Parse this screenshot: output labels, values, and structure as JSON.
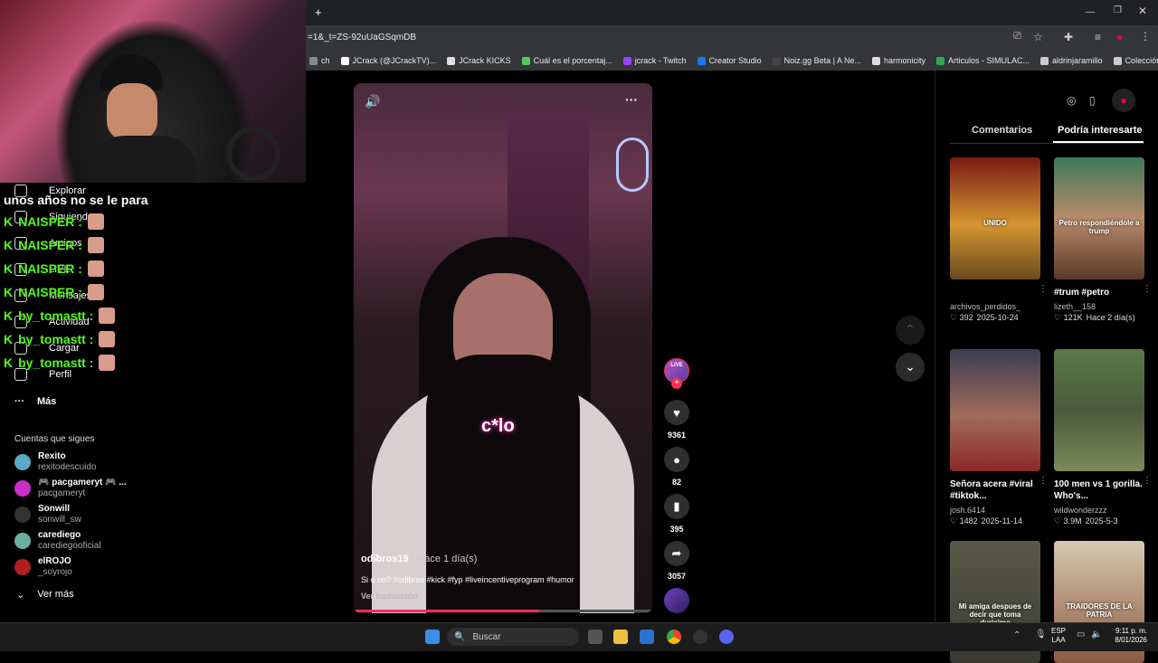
{
  "browser": {
    "new_tab": "+",
    "url": "=1&_t=ZS-92uUaGSqmDB",
    "bookmarks": [
      {
        "label": "ch",
        "color": "#888"
      },
      {
        "label": "JCrack (@JCrackTV)...",
        "color": "#fff"
      },
      {
        "label": "JCrack KICKS",
        "color": "#ddd"
      },
      {
        "label": "Cuál es el porcentaj...",
        "color": "#53c853"
      },
      {
        "label": "jcrack - Twitch",
        "color": "#9146ff"
      },
      {
        "label": "Creator Studio",
        "color": "#1877f2"
      },
      {
        "label": "Noiz.gg Beta | A Ne...",
        "color": "#444"
      },
      {
        "label": "harmonicity",
        "color": "#ddd"
      },
      {
        "label": "Articulos - SIMULAC...",
        "color": "#34a853"
      },
      {
        "label": "aldrinjaramillo",
        "color": "#ccc"
      },
      {
        "label": "Colección de M_blei...",
        "color": "#ccc"
      }
    ],
    "more": "»"
  },
  "sidebar": {
    "nav": [
      {
        "label": "Explorar",
        "icon": "compass-icon"
      },
      {
        "label": "Siguiendo",
        "icon": "following-icon"
      },
      {
        "label": "Amigos",
        "icon": "friends-icon"
      },
      {
        "label": "LIVE",
        "icon": "live-icon"
      },
      {
        "label": "Mensajes",
        "icon": "messages-icon"
      },
      {
        "label": "Actividad",
        "icon": "activity-icon"
      },
      {
        "label": "Cargar",
        "icon": "upload-icon"
      },
      {
        "label": "Perfil",
        "icon": "profile-icon"
      }
    ],
    "more": "Más",
    "following_title": "Cuentas que sigues",
    "following": [
      {
        "name": "Rexito",
        "handle": "rexitodescuido",
        "color": "#5aa9c9"
      },
      {
        "name": "🎮 pacgameryt 🎮 ...",
        "handle": "pacgameryt",
        "color": "#c92ec9"
      },
      {
        "name": "Sonwill",
        "handle": "sonwill_sw",
        "color": "#333"
      },
      {
        "name": "carediego",
        "handle": "carediegooficial",
        "color": "#6ab0a0"
      },
      {
        "name": "elROJO",
        "handle": "_soyrojo",
        "color": "#b02020"
      }
    ],
    "see_more": "Ver más"
  },
  "chat": {
    "top_line": "unos años no se le para",
    "messages": [
      {
        "user": "NAISPER :",
        "k": "K"
      },
      {
        "user": "NAISPER :",
        "k": "K"
      },
      {
        "user": "NAISPER :",
        "k": "K"
      },
      {
        "user": "NAISPER :",
        "k": "K"
      },
      {
        "user": "by_tomastt :",
        "k": "K"
      },
      {
        "user": "by_tomastt :",
        "k": "K"
      },
      {
        "user": "by_tomastt :",
        "k": "K"
      }
    ]
  },
  "video": {
    "caption_overlay": "c*lo",
    "author": "odibros19",
    "time": " · Hace 1 día(s)",
    "description": "Si o no? #odibros #kick #fyp #liveincentiveprogram #humor",
    "translate": "Ver traducción",
    "progress": 0.62
  },
  "actions": {
    "live_badge": "LIVE",
    "likes": "9361",
    "comments": "82",
    "saves": "395",
    "shares": "3057"
  },
  "right_panel": {
    "tabs": [
      "Comentarios",
      "Podría interesarte"
    ],
    "active_tab": 1,
    "cards": [
      {
        "title": "",
        "user": "archivos_perdidos_",
        "likes": "392",
        "date": "2025-10-24",
        "overlay": "UNIDO",
        "bg": "linear-gradient(180deg,#7a1a14 0%,#d49530 55%,#6a4a20 100%)"
      },
      {
        "title": "#trum #petro",
        "user": "lizeth__158",
        "likes": "121K",
        "date": "Hace 2 día(s)",
        "overlay": "Petro respondiéndole a trump",
        "bg": "linear-gradient(180deg,#3e7a5a 0%,#b88a6a 50%,#5a3a2a 100%)"
      },
      {
        "title": "Señora acera #viral #tiktok...",
        "user": "josh.6414",
        "likes": "1482",
        "date": "2025-11-14",
        "overlay": "",
        "bg": "linear-gradient(180deg,#3a3e50 0%,#a06a5a 55%,#8a2a2a 100%)"
      },
      {
        "title": "100 men vs 1 gorilla. Who's...",
        "user": "wildwonderzzz",
        "likes": "3.9M",
        "date": "2025-5-3",
        "overlay": "",
        "bg": "linear-gradient(180deg,#5a7a4a 0%,#4a5a3a 50%,#7a8a5a 100%)"
      },
      {
        "title": "",
        "user": "",
        "likes": "",
        "date": "",
        "overlay": "Mi amiga despues de decir que toma durisimo",
        "bg": "linear-gradient(180deg,#5a5a4a 0%,#3a3a30 100%)"
      },
      {
        "title": "",
        "user": "",
        "likes": "",
        "date": "",
        "overlay": "TRAIDORES DE LA PATRIA",
        "bg": "linear-gradient(180deg,#d8c8b0 0%,#8a5a40 100%)"
      }
    ]
  },
  "taskbar": {
    "search": "Buscar",
    "lang": "ESP",
    "region": "LAA",
    "time": "9:11 p. m.",
    "date": "8/01/2026"
  }
}
